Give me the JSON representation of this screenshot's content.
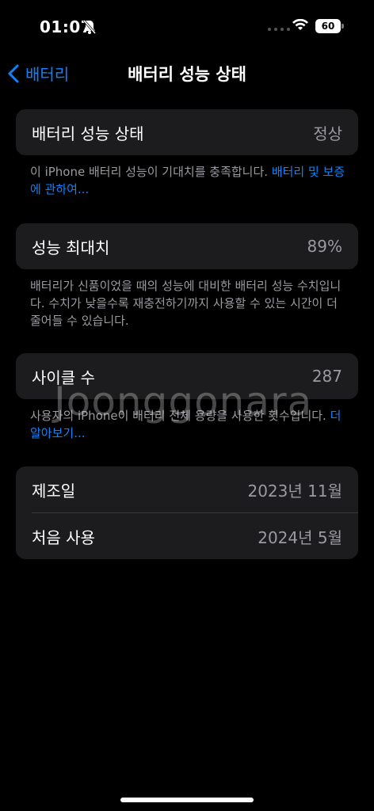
{
  "status": {
    "time": "01:07",
    "battery": "60"
  },
  "nav": {
    "back_label": "배터리",
    "title": "배터리 성능 상태"
  },
  "health": {
    "label": "배터리 성능 상태",
    "value": "정상"
  },
  "health_note": {
    "text": "이 iPhone 배터리 성능이 기대치를 충족합니다. ",
    "link": "배터리 및 보증에 관하여..."
  },
  "capacity": {
    "label": "성능 최대치",
    "value": "89%"
  },
  "capacity_note": {
    "text": "배터리가 신품이었을 때의 성능에 대비한 배터리 성능 수치입니다. 수치가 낮을수록 재충전하기까지 사용할 수 있는 시간이 더 줄어들 수 있습니다."
  },
  "cycle": {
    "label": "사이클 수",
    "value": "287"
  },
  "cycle_note": {
    "text": "사용자의 iPhone이 배터리 전체 용량을 사용한 횟수입니다. ",
    "link": "더 알아보기..."
  },
  "dates": {
    "manufacture_label": "제조일",
    "manufacture_value": "2023년 11월",
    "first_use_label": "처음 사용",
    "first_use_value": "2024년 5월"
  },
  "watermark": "Joonggonara"
}
